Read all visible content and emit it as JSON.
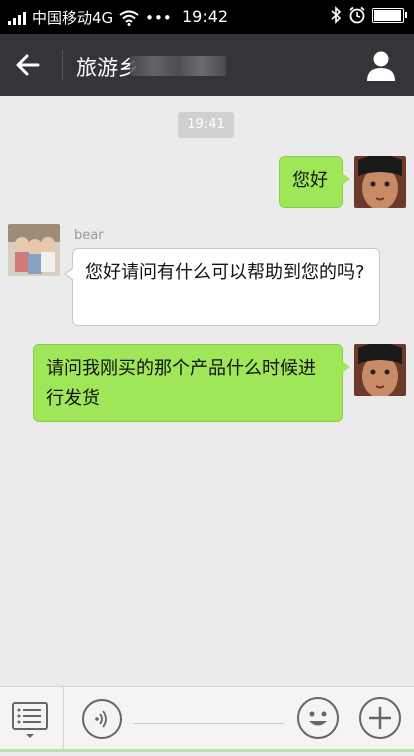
{
  "status_bar": {
    "carrier": "中国移动4G",
    "dots": "•••",
    "time": "19:42"
  },
  "header": {
    "title": "旅游乡"
  },
  "chat": {
    "timestamp": "19:41",
    "messages": [
      {
        "from": "me",
        "text": "您好"
      },
      {
        "from": "bear",
        "sender_name": "bear",
        "text": "您好请问有什么可以帮助到您的吗?"
      },
      {
        "from": "me",
        "text": "请问我刚买的那个产品什么时候进行发货"
      }
    ]
  },
  "colors": {
    "titlebar_bg": "#333538",
    "my_bubble": "#9fe658",
    "chat_bg": "#ebebeb"
  },
  "icons": [
    "back-arrow-icon",
    "contact-icon",
    "menu-list-icon",
    "voice-icon",
    "emoji-icon",
    "plus-icon",
    "wifi-icon",
    "bluetooth-icon",
    "alarm-icon",
    "battery-icon"
  ]
}
